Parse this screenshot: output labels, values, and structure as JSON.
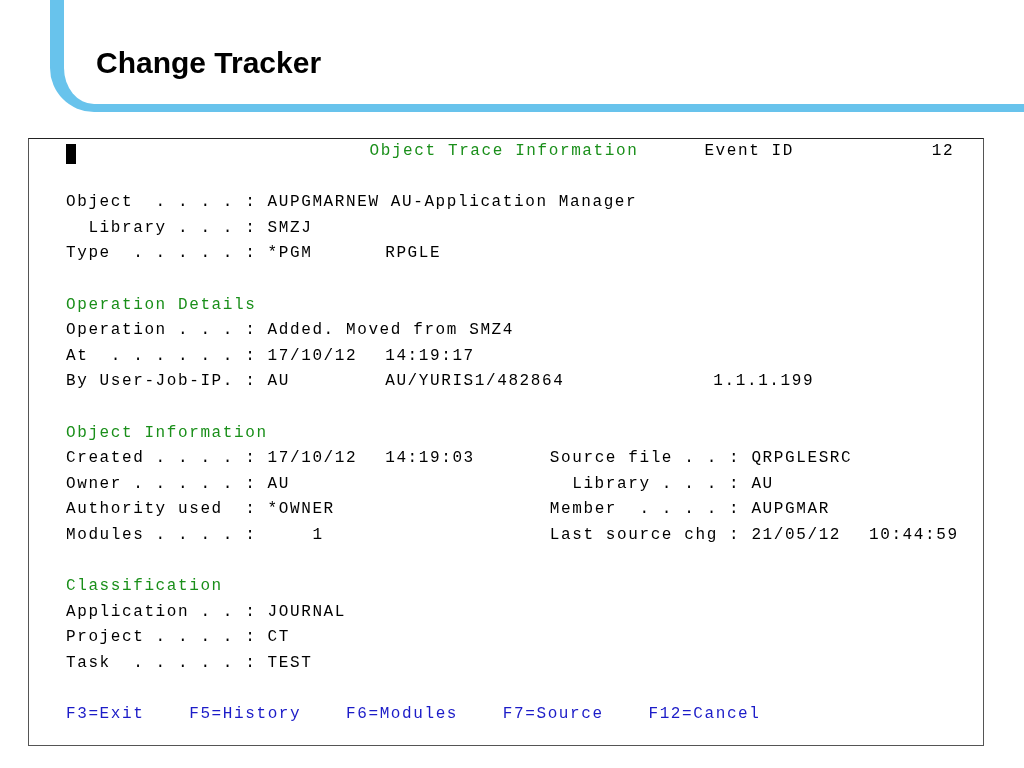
{
  "slide": {
    "title": "Change Tracker"
  },
  "terminal": {
    "title": "Object Trace Information",
    "event_label": "Event ID",
    "event_id": "12",
    "blocks": [
      {
        "columns": [
          [
            {
              "kind": "text",
              "label": "Object  . . . . :",
              "values": [
                "AUPGMARNEW AU-Application Manager"
              ],
              "children": [
                {
                  "kind": "text",
                  "label": "Library . . . :",
                  "values": [
                    "SMZJ"
                  ]
                }
              ]
            },
            {
              "kind": "text",
              "label": "Type  . . . . . :",
              "values": [
                "*PGM",
                "RPGLE"
              ]
            }
          ]
        ]
      },
      {
        "heading": "Operation Details",
        "columns": [
          [
            {
              "kind": "text",
              "label": "Operation . . . :",
              "values": [
                "Added. Moved from SMZ4"
              ]
            },
            {
              "kind": "text",
              "label": "At  . . . . . . :",
              "values": [
                "17/10/12",
                "14:19:17"
              ]
            },
            {
              "kind": "text",
              "label": "By User-Job-IP. :",
              "values": [
                "AU",
                "AU/YURIS1/482864",
                "1.1.1.199"
              ]
            }
          ]
        ]
      },
      {
        "heading": "Object Information",
        "columns": [
          [
            {
              "kind": "text",
              "label": "Created . . . . :",
              "values": [
                "17/10/12",
                "14:19:03"
              ]
            },
            {
              "kind": "text",
              "label": "Owner . . . . . :",
              "values": [
                "AU"
              ]
            },
            {
              "kind": "text",
              "label": "Authority used  :",
              "values": [
                "*OWNER"
              ]
            },
            {
              "kind": "number",
              "label": "Modules . . . . :",
              "values": [
                "1"
              ]
            }
          ],
          [
            {
              "kind": "text",
              "label": "Source file . . :",
              "values": [
                "QRPGLESRC"
              ],
              "children": [
                {
                  "kind": "text",
                  "label": "Library . . . :",
                  "values": [
                    "AU"
                  ]
                }
              ]
            },
            {
              "kind": "text",
              "label": "Member  . . . . :",
              "values": [
                "AUPGMAR"
              ]
            },
            {
              "kind": "text",
              "label": "Last source chg :",
              "values": [
                "21/05/12",
                "10:44:59"
              ]
            }
          ]
        ]
      },
      {
        "heading": "Classification",
        "columns": [
          [
            {
              "kind": "text",
              "label": "Application . . :",
              "values": [
                "JOURNAL"
              ]
            },
            {
              "kind": "text",
              "label": "Project . . . . :",
              "values": [
                "CT"
              ]
            },
            {
              "kind": "text",
              "label": "Task  . . . . . :",
              "values": [
                "TEST"
              ]
            }
          ]
        ]
      }
    ],
    "function_keys": [
      "F3=Exit",
      "F5=History",
      "F6=Modules",
      "F7=Source",
      "F12=Cancel"
    ]
  }
}
